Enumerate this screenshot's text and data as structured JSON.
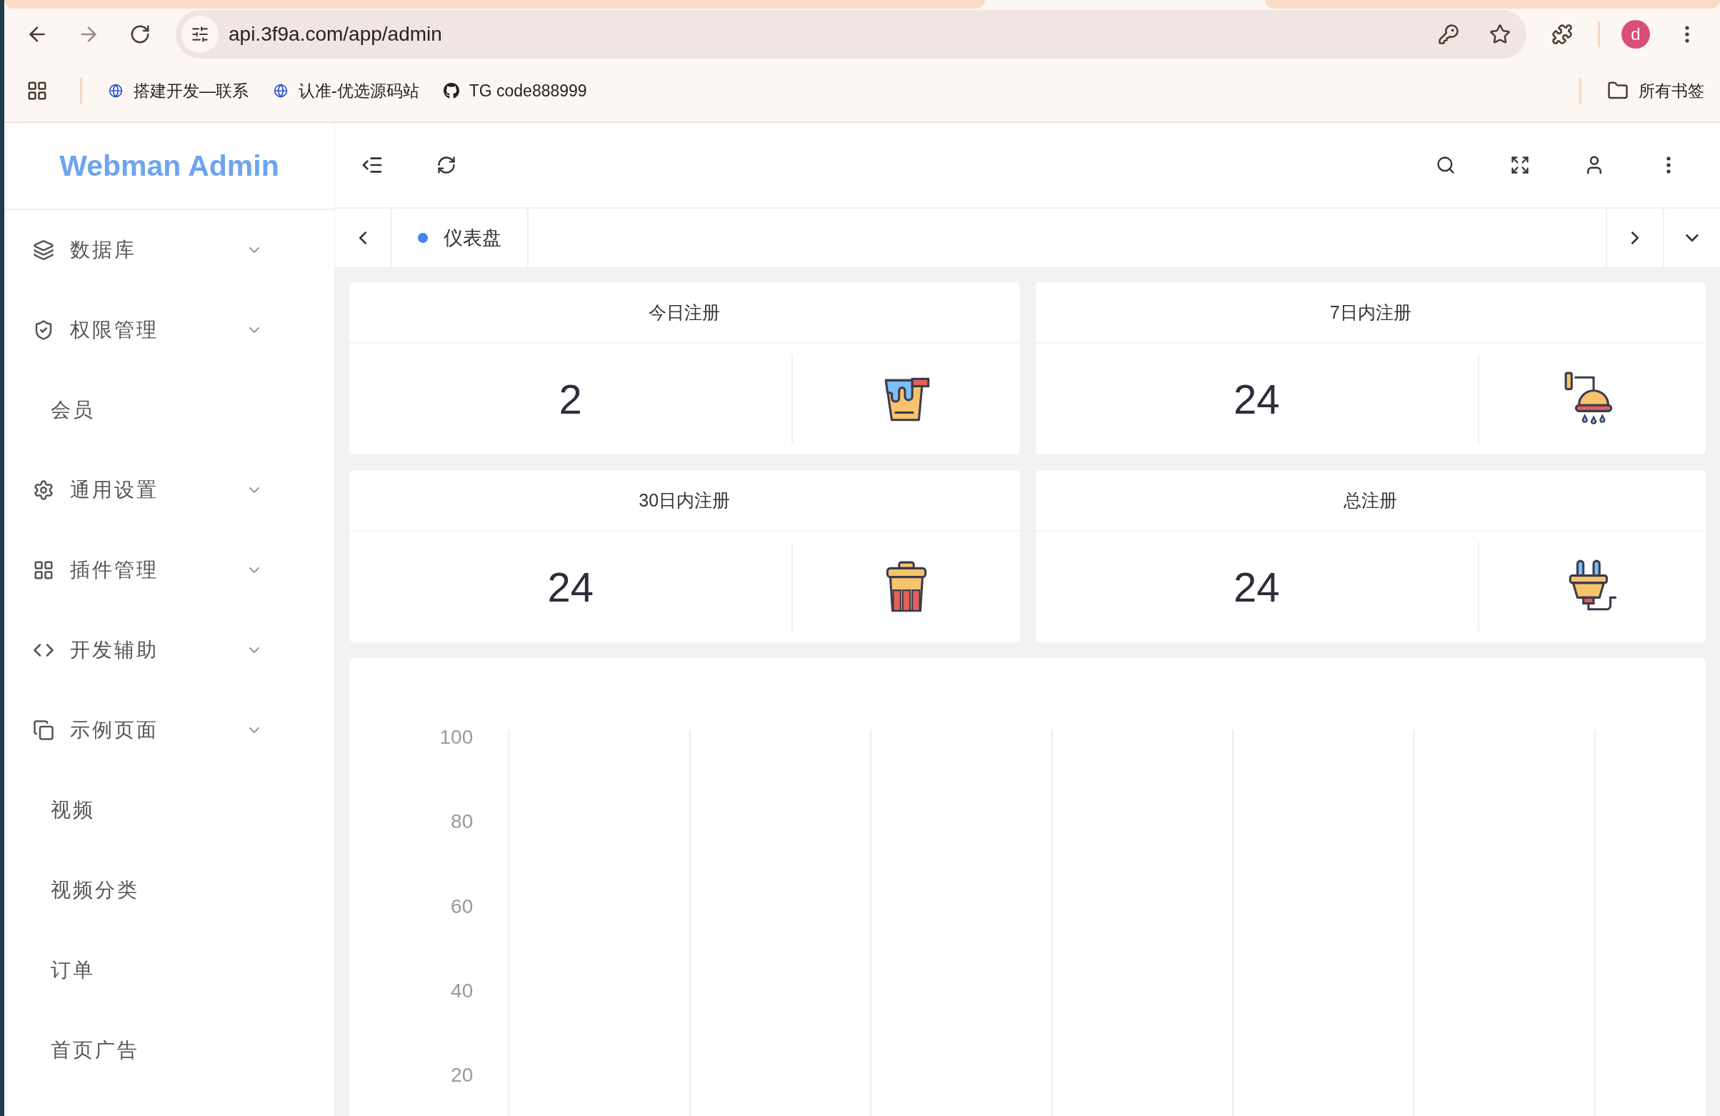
{
  "browser": {
    "url": "api.3f9a.com/app/admin",
    "profile_initial": "d",
    "all_bookmarks": "所有书签",
    "bookmarks": [
      {
        "label": "搭建开发—联系",
        "kind": "site"
      },
      {
        "label": "认准-优选源码站",
        "kind": "site"
      },
      {
        "label": "TG code888999",
        "kind": "github"
      }
    ]
  },
  "sidebar": {
    "logo": "Webman Admin",
    "items": [
      {
        "label": "数据库"
      },
      {
        "label": "权限管理",
        "children": [
          {
            "label": "会员"
          }
        ]
      },
      {
        "label": "通用设置"
      },
      {
        "label": "插件管理"
      },
      {
        "label": "开发辅助"
      },
      {
        "label": "示例页面",
        "children": [
          {
            "label": "视频"
          },
          {
            "label": "视频分类"
          },
          {
            "label": "订单"
          },
          {
            "label": "首页广告"
          }
        ]
      }
    ]
  },
  "tabs": [
    {
      "label": "仪表盘",
      "selected": true
    }
  ],
  "stats": [
    {
      "title": "今日注册",
      "value": "2",
      "kind": "bucket"
    },
    {
      "title": "7日内注册",
      "value": "24",
      "kind": "shower"
    },
    {
      "title": "30日内注册",
      "value": "24",
      "kind": "bin"
    },
    {
      "title": "总注册",
      "value": "24",
      "kind": "plug"
    }
  ],
  "chart": {
    "y_axis_labels": [
      "100",
      "80",
      "60",
      "40",
      "20"
    ]
  }
}
